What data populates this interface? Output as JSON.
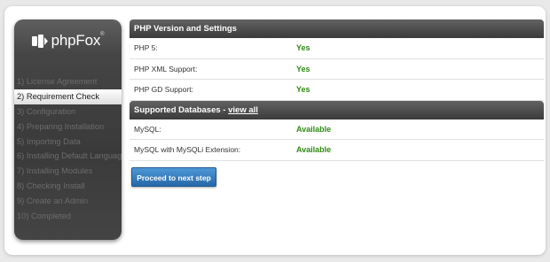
{
  "brand": {
    "name": "phpFox",
    "trademark": "®"
  },
  "steps": [
    {
      "label": "1) License Agreement",
      "active": false
    },
    {
      "label": "2) Requirement Check",
      "active": true
    },
    {
      "label": "3) Configuration",
      "active": false
    },
    {
      "label": "4) Preparing Installation",
      "active": false
    },
    {
      "label": "5) Importing Data",
      "active": false
    },
    {
      "label": "6) Installing Default Language",
      "active": false
    },
    {
      "label": "7) Installing Modules",
      "active": false
    },
    {
      "label": "8) Checking Install",
      "active": false
    },
    {
      "label": "9) Create an Admin",
      "active": false
    },
    {
      "label": "10) Completed",
      "active": false
    }
  ],
  "php_section": {
    "title": "PHP Version and Settings",
    "rows": [
      {
        "label": "PHP 5:",
        "value": "Yes"
      },
      {
        "label": "PHP XML Support:",
        "value": "Yes"
      },
      {
        "label": "PHP GD Support:",
        "value": "Yes"
      }
    ]
  },
  "db_section": {
    "title": "Supported Databases - ",
    "link": "view all",
    "rows": [
      {
        "label": "MySQL:",
        "value": "Available"
      },
      {
        "label": "MySQL with MySQLi Extension:",
        "value": "Available"
      }
    ]
  },
  "proceed_button": "Proceed to next step",
  "colors": {
    "status_ok": "#2e8a14",
    "button": "#2f74b6",
    "header": "#4a4a4a"
  }
}
